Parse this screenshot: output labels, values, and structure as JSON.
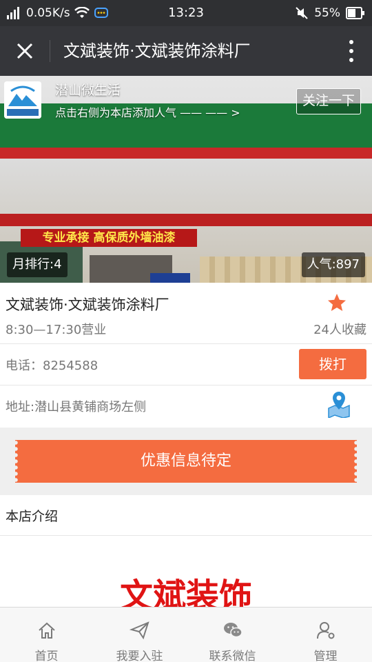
{
  "status_bar": {
    "network": "0.05K/s",
    "time": "13:23",
    "battery": "55%"
  },
  "title_bar": {
    "title": "文斌装饰·文斌装饰涂料厂"
  },
  "hero": {
    "brand_name": "潜山微生活",
    "brand_sub": "点击右侧为本店添加人气 —— —— >",
    "follow_label": "关注一下",
    "rank_label": "月排行:4",
    "popularity_label": "人气:897",
    "sign_text": "专业承接 高保质外墙油漆"
  },
  "shop": {
    "name": "文斌装饰·文斌装饰涂料厂",
    "hours": "8:30—17:30营业",
    "favorites": "24人收藏",
    "phone": "电话：8254588",
    "call_label": "拨打",
    "address": "地址:潜山县黄铺商场左侧"
  },
  "coupon": {
    "label": "优惠信息待定"
  },
  "intro": {
    "title": "本店介绍",
    "heading": "文斌装饰"
  },
  "bottom_nav": {
    "items": [
      {
        "label": "首页",
        "icon": "home-icon"
      },
      {
        "label": "我要入驻",
        "icon": "send-icon"
      },
      {
        "label": "联系微信",
        "icon": "wechat-icon"
      },
      {
        "label": "管理",
        "icon": "user-manage-icon"
      }
    ]
  },
  "colors": {
    "accent": "#f46c40",
    "star": "#f46c40",
    "heading_red": "#e01414"
  }
}
